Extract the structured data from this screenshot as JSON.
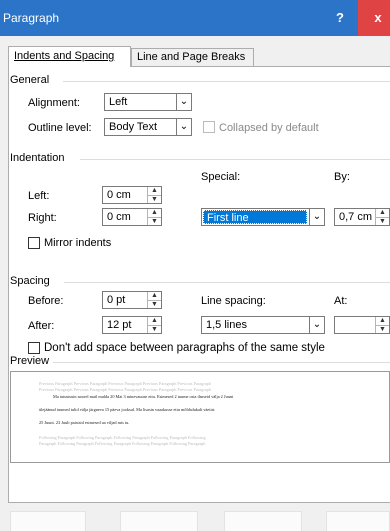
{
  "window": {
    "title": "Paragraph",
    "help_label": "?",
    "close_label": "x"
  },
  "tabs": [
    {
      "label": "Indents and Spacing",
      "active": true
    },
    {
      "label": "Line and Page Breaks",
      "active": false
    }
  ],
  "general": {
    "section_label": "General",
    "alignment_label": "Alignment:",
    "alignment_value": "Left",
    "outline_label": "Outline level:",
    "outline_value": "Body Text",
    "collapsed_label": "Collapsed by default"
  },
  "indentation": {
    "section_label": "Indentation",
    "left_label": "Left:",
    "left_value": "0 cm",
    "right_label": "Right:",
    "right_value": "0 cm",
    "special_label": "Special:",
    "special_value": "First line",
    "by_label": "By:",
    "by_value": "0,7 cm",
    "mirror_label": "Mirror indents"
  },
  "spacing": {
    "section_label": "Spacing",
    "before_label": "Before:",
    "before_value": "0 pt",
    "after_label": "After:",
    "after_value": "12 pt",
    "line_spacing_label": "Line spacing:",
    "line_spacing_value": "1,5 lines",
    "at_label": "At:",
    "at_value": "",
    "dont_add_label": "Don't add space between paragraphs of the same style"
  },
  "preview": {
    "section_label": "Preview",
    "prev_line_1": "Previous Paragraph Previous Paragraph Previous Paragraph Previous Paragraph Previous Paragraph",
    "prev_line_2": "Previous Paragraph Previous Paragraph Previous Paragraph Previous Paragraph Previous Paragraph",
    "text_line_1": "Ma tutustusin noorel mail mulda 20 Mai 3 minevauuse ettu. Esimesed 2 tuume osta ilmseid välja 2 Juuni",
    "text_line_2": "ülejäänud tuumed tulid välja järgneva 15 päeva jooksul. Ma lisasin vaaakusse ettu mõldsdukalt väetist",
    "text_line_3": "25 Juuni. 23 Juuli paistsid esimesed ua viljad mis tu.",
    "next_line_1": "Following Paragraph Following Paragraph Following Paragraph Following Paragraph Following",
    "next_line_2": "Paragraph Following Paragraph Following Paragraph Following Paragraph Following Paragraph"
  }
}
